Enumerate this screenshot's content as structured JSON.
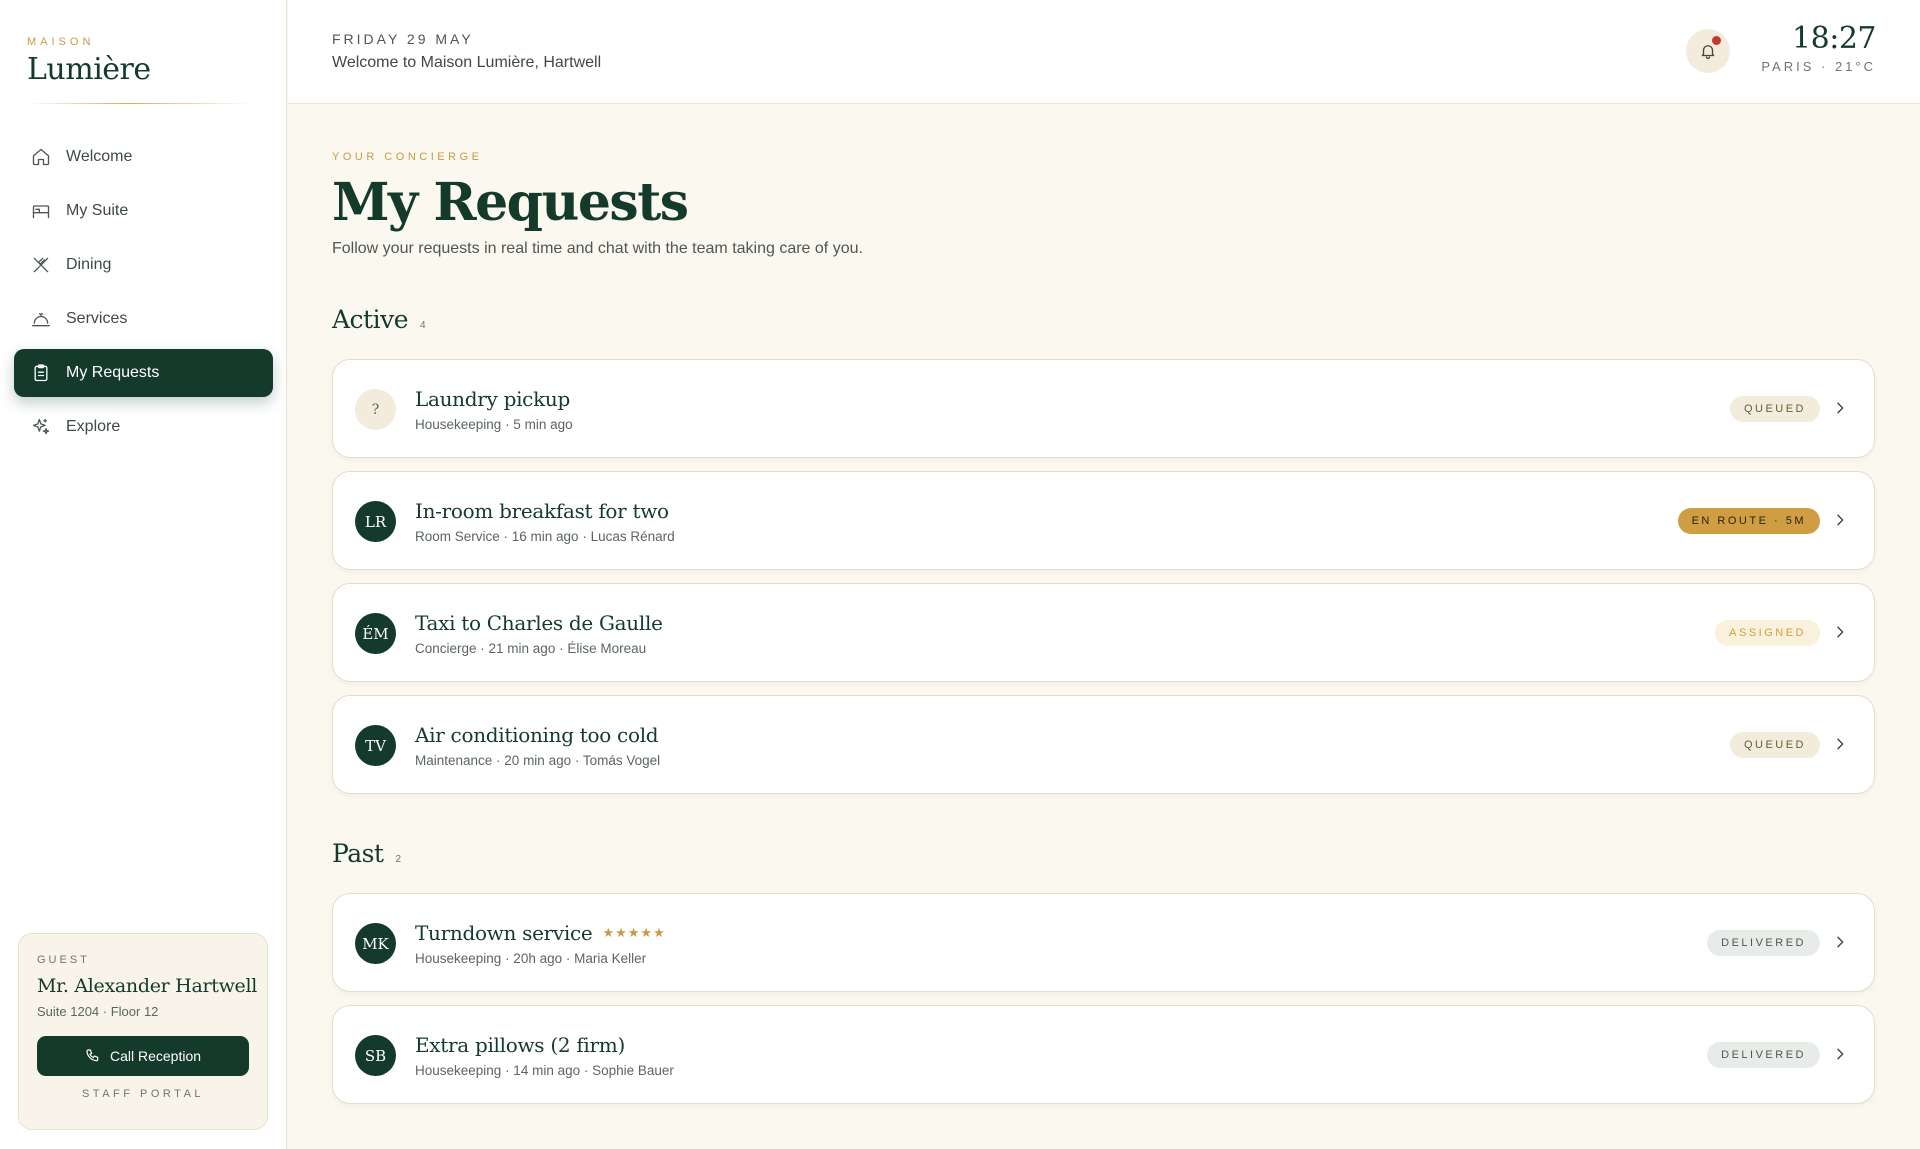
{
  "brand": {
    "small": "MAISON",
    "name": "Lumière"
  },
  "nav": [
    {
      "label": "Welcome",
      "icon": "home-icon"
    },
    {
      "label": "My Suite",
      "icon": "bed-icon"
    },
    {
      "label": "Dining",
      "icon": "utensils-icon"
    },
    {
      "label": "Services",
      "icon": "bell-service-icon"
    },
    {
      "label": "My Requests",
      "icon": "clipboard-icon",
      "active": true
    },
    {
      "label": "Explore",
      "icon": "sparkles-icon"
    }
  ],
  "guest": {
    "label": "GUEST",
    "name": "Mr. Alexander Hartwell",
    "suite": "Suite 1204 · Floor 12",
    "call_label": "Call Reception",
    "staff_portal": "STAFF PORTAL"
  },
  "header": {
    "date": "FRIDAY 29 MAY",
    "welcome": "Welcome to Maison Lumière, Hartwell",
    "time": "18:27",
    "location": "PARIS · 21°C"
  },
  "page": {
    "eyebrow": "YOUR CONCIERGE",
    "title": "My Requests",
    "subtitle": "Follow your requests in real time and chat with the team taking care of you."
  },
  "active": {
    "title": "Active",
    "count": "4",
    "items": [
      {
        "avatar": "?",
        "title": "Laundry pickup",
        "meta": "Housekeeping · 5 min ago",
        "status": "QUEUED"
      },
      {
        "avatar": "LR",
        "title": "In-room breakfast for two",
        "meta": "Room Service · 16 min ago · Lucas Rénard",
        "status": "EN ROUTE · 5M"
      },
      {
        "avatar": "ÉM",
        "title": "Taxi to Charles de Gaulle",
        "meta": "Concierge · 21 min ago · Élise Moreau",
        "status": "ASSIGNED"
      },
      {
        "avatar": "TV",
        "title": "Air conditioning too cold",
        "meta": "Maintenance · 20 min ago · Tomás Vogel",
        "status": "QUEUED"
      }
    ]
  },
  "past": {
    "title": "Past",
    "count": "2",
    "items": [
      {
        "avatar": "MK",
        "title": "Turndown service",
        "rating": 5,
        "stars": "★★★★★",
        "meta": "Housekeeping · 20h ago · Maria Keller",
        "status": "DELIVERED"
      },
      {
        "avatar": "SB",
        "title": "Extra pillows (2 firm)",
        "meta": "Housekeeping · 14 min ago · Sophie Bauer",
        "status": "DELIVERED"
      }
    ]
  },
  "colors": {
    "brand_green": "#143a2c",
    "gold": "#c99a44",
    "background": "#fbf8ef",
    "notification_dot": "#c8372d"
  }
}
